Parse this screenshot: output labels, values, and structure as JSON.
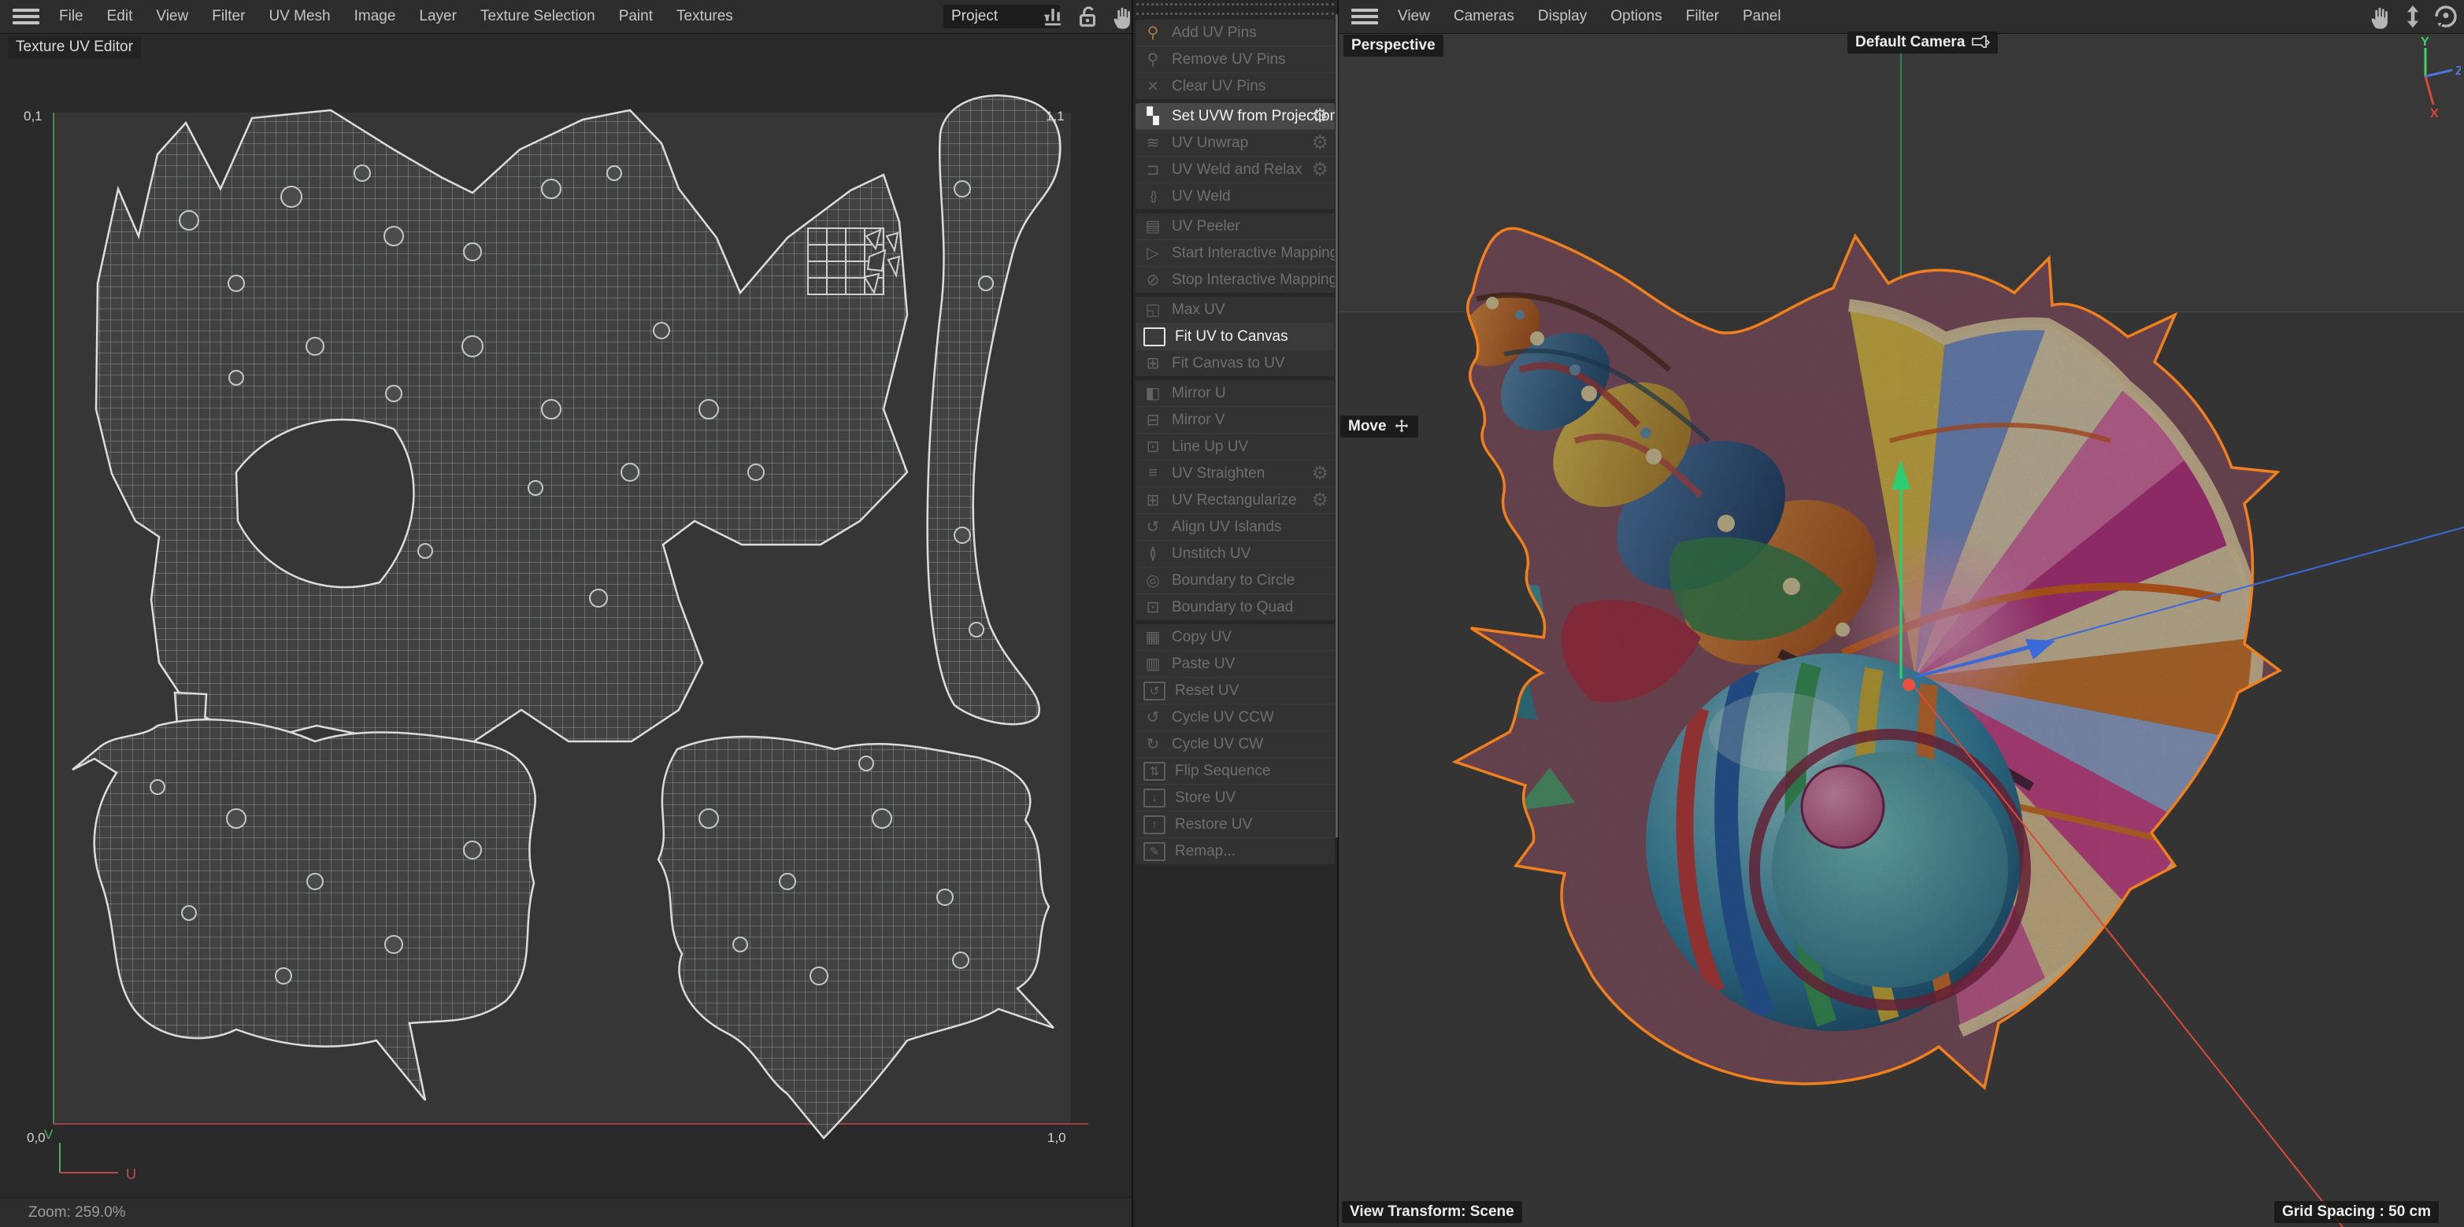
{
  "left_menubar": {
    "items": [
      "File",
      "Edit",
      "View",
      "Filter",
      "UV Mesh",
      "Image",
      "Layer",
      "Texture Selection",
      "Paint",
      "Textures"
    ],
    "project_label": "Project",
    "icons": [
      "histogram-icon",
      "unlock-icon",
      "pan-hand-icon",
      "move-vertical-icon"
    ]
  },
  "uv_editor": {
    "title": "Texture UV Editor",
    "corner_top_left": "0,1",
    "corner_top_right": "1,1",
    "corner_bottom_left": "0,0",
    "corner_bottom_right": "1,0",
    "axis_u": "U",
    "axis_v": "V",
    "zoom_status": "Zoom: 259.0%"
  },
  "tool_panel": {
    "groups": [
      {
        "items": [
          {
            "label": "Add UV Pins",
            "icon": "pin",
            "enabled": false
          },
          {
            "label": "Remove UV Pins",
            "icon": "pin",
            "enabled": false
          },
          {
            "label": "Clear UV Pins",
            "icon": "clear",
            "enabled": false
          }
        ]
      },
      {
        "items": [
          {
            "label": "Set UVW from Projection",
            "icon": "projection",
            "gear": true,
            "enabled": true,
            "highlighted": true
          },
          {
            "label": "UV Unwrap",
            "icon": "unwrap",
            "gear": true,
            "enabled": false
          },
          {
            "label": "UV Weld and Relax",
            "icon": "weld-relax",
            "gear": true,
            "enabled": false
          },
          {
            "label": "UV Weld",
            "icon": "weld",
            "enabled": false
          }
        ]
      },
      {
        "items": [
          {
            "label": "UV Peeler",
            "icon": "peeler",
            "enabled": false
          },
          {
            "label": "Start Interactive Mapping",
            "icon": "play",
            "enabled": false
          },
          {
            "label": "Stop Interactive Mapping",
            "icon": "stop",
            "enabled": false
          }
        ]
      },
      {
        "items": [
          {
            "label": "Max UV",
            "icon": "max",
            "enabled": false
          },
          {
            "label": "Fit UV to Canvas",
            "icon": "fit-canvas",
            "enabled": true
          },
          {
            "label": "Fit Canvas to UV",
            "icon": "fit-uv",
            "enabled": false
          }
        ]
      },
      {
        "items": [
          {
            "label": "Mirror U",
            "icon": "mirror-u",
            "enabled": false
          },
          {
            "label": "Mirror V",
            "icon": "mirror-v",
            "enabled": false
          },
          {
            "label": "Line Up UV",
            "icon": "line-up",
            "enabled": false
          },
          {
            "label": "UV Straighten",
            "icon": "straighten",
            "gear": true,
            "enabled": false
          },
          {
            "label": "UV Rectangularize",
            "icon": "rect",
            "gear": true,
            "enabled": false
          },
          {
            "label": "Align UV Islands",
            "icon": "align",
            "enabled": false
          },
          {
            "label": "Unstitch UV",
            "icon": "unstitch",
            "enabled": false
          },
          {
            "label": "Boundary to Circle",
            "icon": "circle",
            "enabled": false
          },
          {
            "label": "Boundary to Quad",
            "icon": "quad",
            "enabled": false
          }
        ]
      },
      {
        "items": [
          {
            "label": "Copy UV",
            "icon": "copy",
            "enabled": false
          },
          {
            "label": "Paste UV",
            "icon": "paste",
            "enabled": false
          },
          {
            "label": "Reset UV",
            "icon": "reset",
            "enabled": false
          },
          {
            "label": "Cycle UV CCW",
            "icon": "ccw",
            "enabled": false
          },
          {
            "label": "Cycle UV CW",
            "icon": "cw",
            "enabled": false
          },
          {
            "label": "Flip Sequence",
            "icon": "flip",
            "enabled": false
          },
          {
            "label": "Store UV",
            "icon": "store",
            "enabled": false
          },
          {
            "label": "Restore UV",
            "icon": "restore",
            "enabled": false
          },
          {
            "label": "Remap...",
            "icon": "remap",
            "enabled": false
          }
        ]
      }
    ]
  },
  "right_menubar": {
    "items": [
      "View",
      "Cameras",
      "Display",
      "Options",
      "Filter",
      "Panel"
    ],
    "icons": [
      "pan-hand-icon",
      "move-vertical-icon",
      "orbit-icon",
      "maximize-icon"
    ]
  },
  "viewport": {
    "view_label": "Perspective",
    "camera_label": "Default Camera",
    "tool_label": "Move",
    "bottom_left_label": "View Transform: Scene",
    "bottom_right_label": "Grid Spacing : 50 cm",
    "axis_gizmo": {
      "x": "X",
      "y": "Y",
      "z": "Z"
    },
    "colors": {
      "axis_x": "#d84a3a",
      "axis_y": "#3fd06a",
      "axis_z": "#4a78d8",
      "selection_outline": "#f07f1e"
    }
  }
}
